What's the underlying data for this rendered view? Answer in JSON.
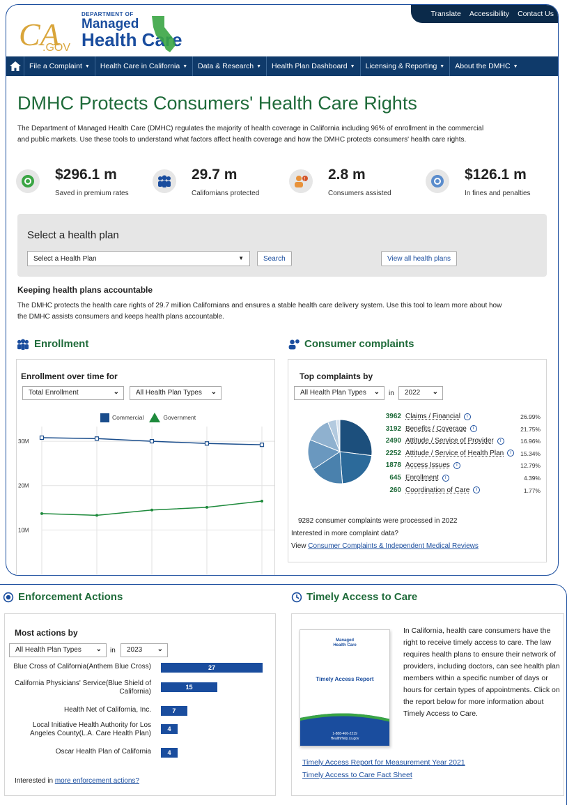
{
  "utility": {
    "translate": "Translate",
    "accessibility": "Accessibility",
    "contact": "Contact Us"
  },
  "logo": {
    "ca": "CA",
    "gov": ".GOV",
    "dept_small": "DEPARTMENT OF",
    "dept_line1": "Managed",
    "dept_line2": "Health Care"
  },
  "nav": {
    "items": [
      {
        "label": "File a Complaint"
      },
      {
        "label": "Health Care in California"
      },
      {
        "label": "Data & Research"
      },
      {
        "label": "Health Plan Dashboard"
      },
      {
        "label": "Licensing & Reporting"
      },
      {
        "label": "About the DMHC"
      }
    ]
  },
  "page": {
    "title": "DMHC Protects Consumers' Health Care Rights",
    "intro": "The Department of Managed Health Care (DMHC) regulates the majority of health coverage in California including 96% of enrollment in the commercial and public markets. Use these tools to understand what factors affect health coverage and how the DMHC protects consumers' health care rights."
  },
  "stats": [
    {
      "value": "$296.1 m",
      "label": "Saved in premium rates",
      "icon": "money-icon"
    },
    {
      "value": "29.7 m",
      "label": "Californians protected",
      "icon": "people-icon"
    },
    {
      "value": "2.8 m",
      "label": "Consumers assisted",
      "icon": "assist-icon"
    },
    {
      "value": "$126.1 m",
      "label": "In fines and penalties",
      "icon": "badge-icon"
    }
  ],
  "select_plan": {
    "title": "Select a health plan",
    "placeholder": "Select a Health Plan",
    "search": "Search",
    "view_all": "View all health plans"
  },
  "accountable": {
    "title": "Keeping health plans accountable",
    "text": "The DMHC protects the health care rights of 29.7 million Californians and ensures a stable health care delivery system. Use this tool to learn more about how the DMHC assists consumers and keeps health plans accountable."
  },
  "enrollment": {
    "heading": "Enrollment",
    "panel_title": "Enrollment over time for",
    "dd1": "Total Enrollment",
    "dd2": "All Health Plan Types"
  },
  "complaints": {
    "heading": "Consumer complaints",
    "panel_title": "Top complaints by",
    "dd1": "All Health Plan Types",
    "in": "in",
    "year": "2022",
    "summary": "9282 consumer complaints were processed in 2022",
    "interested": "Interested in more complaint data?",
    "view_prefix": "View ",
    "view_link": "Consumer Complaints & Independent Medical Reviews"
  },
  "enforcement": {
    "heading": "Enforcement Actions",
    "panel_title": "Most actions by",
    "dd1": "All Health Plan Types",
    "in": "in",
    "year": "2023",
    "interested_prefix": "Interested in ",
    "interested_link": "more enforcement actions?",
    "bars": [
      {
        "label": "Blue Cross of California(Anthem Blue Cross)",
        "value": 27
      },
      {
        "label": "California Physicians' Service(Blue Shield of California)",
        "value": 15
      },
      {
        "label": "Health Net of California, Inc.",
        "value": 7
      },
      {
        "label": "Local Initiative Health Authority for Los Angeles County(L.A. Care Health Plan)",
        "value": 4
      },
      {
        "label": "Oscar Health Plan of California",
        "value": 4
      }
    ]
  },
  "timely": {
    "heading": "Timely Access to Care",
    "text": "In California, health care consumers have the right to receive timely access to care. The law requires health plans to ensure their network of providers, including doctors, can see health plan members within a specific number of days or hours for certain types of appointments. Click on the report below for more information about Timely Access to Care.",
    "report_title": "Timely Access Report",
    "report_logo1": "Managed",
    "report_logo2": "Health Care",
    "report_phone": "1-888-466-2219",
    "report_site": "HealthHelp.ca.gov",
    "link1": "Timely Access Report for Measurement Year 2021",
    "link2": "Timely Access to Care Fact Sheet"
  },
  "colors": {
    "green": "#1f6b3a",
    "blue": "#1a4d9e",
    "navy": "#0f3a6a",
    "commercial": "#1a4d8c",
    "government": "#1e8a3c"
  },
  "chart_data": [
    {
      "type": "line",
      "title": "Enrollment over time for",
      "x": [
        1,
        2,
        3,
        4,
        5
      ],
      "series": [
        {
          "name": "Commercial",
          "values": [
            30.8,
            30.6,
            30.0,
            29.5,
            29.2
          ]
        },
        {
          "name": "Government",
          "values": [
            13.7,
            13.3,
            14.5,
            15.1,
            16.5
          ]
        }
      ],
      "yticks": [
        "30M",
        "20M",
        "10M"
      ],
      "ylim": [
        0,
        33
      ],
      "grid": true,
      "legend": "top"
    },
    {
      "type": "pie",
      "title": "Top complaints by",
      "slices": [
        {
          "label": "Claims / Financial",
          "count": 3962,
          "pct": "26.99%",
          "value": 26.99,
          "color": "#1c4f7c"
        },
        {
          "label": "Benefits / Coverage",
          "count": 3192,
          "pct": "21.75%",
          "value": 21.75,
          "color": "#2c6a9a"
        },
        {
          "label": "Attitude / Service of Provider",
          "count": 2490,
          "pct": "16.96%",
          "value": 16.96,
          "color": "#4a81ad"
        },
        {
          "label": "Attitude / Service of Health Plan",
          "count": 2252,
          "pct": "15.34%",
          "value": 15.34,
          "color": "#6a98bf"
        },
        {
          "label": "Access Issues",
          "count": 1878,
          "pct": "12.79%",
          "value": 12.79,
          "color": "#8fb1cf"
        },
        {
          "label": "Enrollment",
          "count": 645,
          "pct": "4.39%",
          "value": 4.39,
          "color": "#b3cadf"
        },
        {
          "label": "Coordination of Care",
          "count": 260,
          "pct": "1.77%",
          "value": 1.77,
          "color": "#d6e2ee"
        }
      ]
    },
    {
      "type": "bar",
      "title": "Most actions by",
      "categories": [
        "Blue Cross of California(Anthem Blue Cross)",
        "California Physicians' Service(Blue Shield of California)",
        "Health Net of California, Inc.",
        "Local Initiative Health Authority for Los Angeles County(L.A. Care Health Plan)",
        "Oscar Health Plan of California"
      ],
      "values": [
        27,
        15,
        7,
        4,
        4
      ]
    }
  ]
}
